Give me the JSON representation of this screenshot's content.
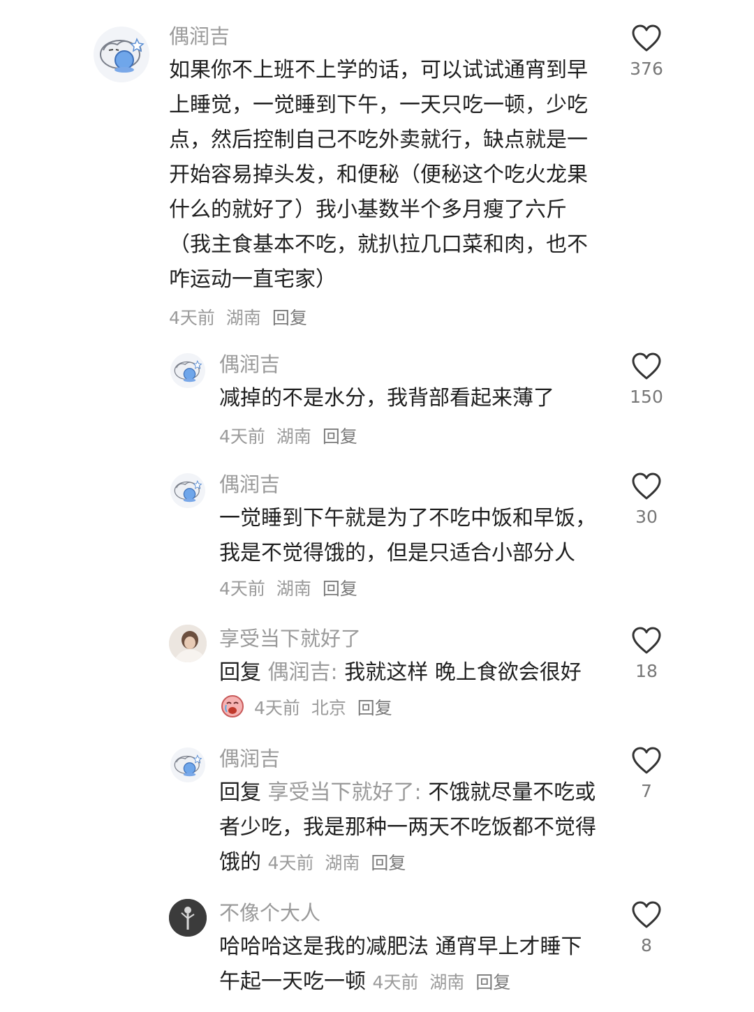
{
  "comments": [
    {
      "user": "偶润吉",
      "text": "如果你不上班不上学的话，可以试试通宵到早上睡觉，一觉睡到下午，一天只吃一顿，少吃点，然后控制自己不吃外卖就行，缺点就是一开始容易掉头发，和便秘（便秘这个吃火龙果什么的就好了）我小基数半个多月瘦了六斤（我主食基本不吃，就扒拉几口菜和肉，也不咋运动一直宅家）",
      "time": "4天前",
      "location": "湖南",
      "reply_label": "回复",
      "likes": "376"
    },
    {
      "user": "偶润吉",
      "text": "减掉的不是水分，我背部看起来薄了",
      "time": "4天前",
      "location": "湖南",
      "reply_label": "回复",
      "likes": "150"
    },
    {
      "user": "偶润吉",
      "text": "一觉睡到下午就是为了不吃中饭和早饭，我是不觉得饿的，但是只适合小部分人",
      "time": "4天前",
      "location": "湖南",
      "reply_label": "回复",
      "likes": "30"
    },
    {
      "user": "享受当下就好了",
      "reply_prefix": "回复",
      "reply_target": "偶润吉:",
      "text": " 我就这样 晚上食欲会很好",
      "emoji": "crying-face-emoji",
      "time": "4天前",
      "location": "北京",
      "reply_label": "回复",
      "likes": "18"
    },
    {
      "user": "偶润吉",
      "reply_prefix": "回复",
      "reply_target": "享受当下就好了:",
      "text": " 不饿就尽量不吃或者少吃，我是那种一两天不吃饭都不觉得饿的",
      "time": "4天前",
      "location": "湖南",
      "reply_label": "回复",
      "likes": "7"
    },
    {
      "user": "不像个大人",
      "text": "哈哈哈这是我的减肥法 通宵早上才睡下午起一天吃一顿",
      "time": "4天前",
      "location": "湖南",
      "reply_label": "回复",
      "likes": "8"
    }
  ],
  "icons": {
    "like": "heart-outline-icon"
  },
  "colors": {
    "text": "#1f1f1f",
    "muted": "#9a9a9a"
  }
}
